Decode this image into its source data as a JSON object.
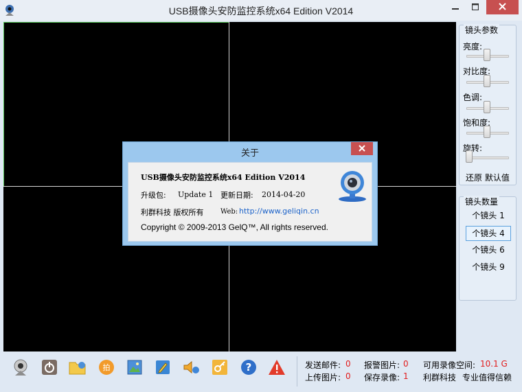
{
  "window": {
    "title": "USB摄像头安防监控系统x64 Edition V2014"
  },
  "camera_params": {
    "title": "镜头参数",
    "items": [
      {
        "label": "亮度:",
        "value": 0.5
      },
      {
        "label": "对比度:",
        "value": 0.5
      },
      {
        "label": "色调:",
        "value": 0.5
      },
      {
        "label": "饱和度:",
        "value": 0.5
      },
      {
        "label": "旋转:",
        "value": 0.0
      }
    ],
    "reset_label": "还原 默认值"
  },
  "camera_count": {
    "title": "镜头数量",
    "options": [
      "个镜头 1",
      "个镜头 4",
      "个镜头 6",
      "个镜头 9"
    ],
    "selected_index": 1
  },
  "about": {
    "title": "关于",
    "product": "USB摄像头安防监控系统x64 Edition V2014",
    "upgrade_label": "升级包:",
    "upgrade_value": "Update 1",
    "date_label": "更新日期:",
    "date_value": "2014-04-20",
    "rights": "利群科技 版权所有",
    "web_label": "Web:",
    "web_url": "http://www.geliqin.cn",
    "copyright": "Copyright © 2009-2013 GelQ™, All rights reserved."
  },
  "toolbar": {
    "icons": [
      "webcam-icon",
      "power-icon",
      "folder-settings-icon",
      "snapshot-icon",
      "image-icon",
      "edit-icon",
      "audio-icon",
      "key-icon",
      "help-icon",
      "warning-icon"
    ]
  },
  "status": {
    "send_mail_label": "发送邮件:",
    "send_mail_value": "0",
    "alarm_pic_label": "报警图片:",
    "alarm_pic_value": "0",
    "space_label": "可用录像空间:",
    "space_value": "10.1 G",
    "upload_pic_label": "上传图片:",
    "upload_pic_value": "0",
    "save_video_label": "保存录像:",
    "save_video_value": "1",
    "brand": "利群科技",
    "slogan": "专业值得信赖"
  },
  "colors": {
    "close_red": "#c75050",
    "active_border": "#5aa0de",
    "selected_cell_border": "#4fbf4f",
    "status_red": "#e21b1b"
  }
}
